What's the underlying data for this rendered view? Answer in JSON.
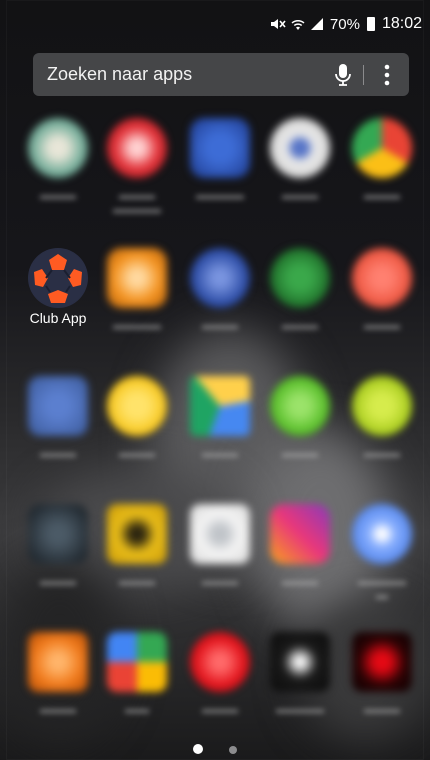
{
  "status_bar": {
    "battery_percent": "70%",
    "time": "18:02"
  },
  "search": {
    "placeholder": "Zoeken naar apps"
  },
  "apps": {
    "club": {
      "label": "Club App"
    }
  },
  "page_indicator": {
    "pages": 2,
    "active": 1
  },
  "colors": {
    "club_icon_bg": "#2a2f45",
    "club_icon_accent": "#ff5b22"
  }
}
